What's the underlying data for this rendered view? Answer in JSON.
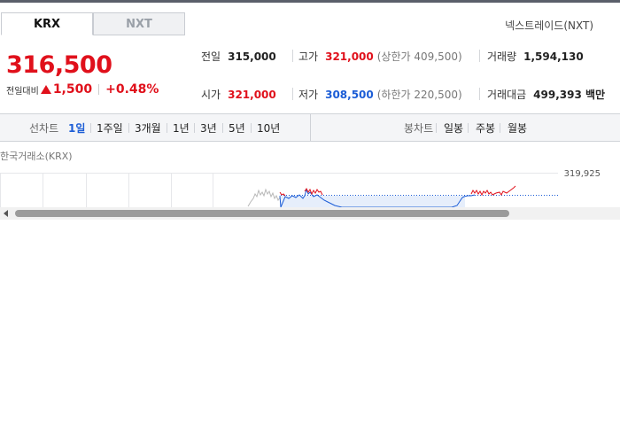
{
  "tabs": {
    "krx": "KRX",
    "nxt": "NXT"
  },
  "nxt_link": "넥스트레이드(NXT)",
  "price": {
    "current": "316,500",
    "change_label": "전일대비",
    "change_amount": "1,500",
    "change_percent": "+0.48%"
  },
  "stats": {
    "prev_close": {
      "label": "전일",
      "value": "315,000"
    },
    "high": {
      "label": "고가",
      "value": "321,000",
      "sub": "(상한가 409,500)"
    },
    "volume": {
      "label": "거래량",
      "value": "1,594,130"
    },
    "open": {
      "label": "시가",
      "value": "321,000"
    },
    "low": {
      "label": "저가",
      "value": "308,500",
      "sub": "(하한가 220,500)"
    },
    "amount": {
      "label": "거래대금",
      "value": "499,393 백만"
    }
  },
  "toolbar": {
    "line_chart_label": "선차트",
    "periods": [
      "1일",
      "1주일",
      "3개월",
      "1년",
      "3년",
      "5년",
      "10년"
    ],
    "candle_label": "봉차트",
    "candle_periods": [
      "일봉",
      "주봉",
      "월봉"
    ]
  },
  "chart_data": {
    "type": "line",
    "caption": "한국거래소(KRX)",
    "y_top_label": "319,925"
  },
  "colors": {
    "up": "#e0101b",
    "down": "#1c5dd6",
    "accent": "#1c5dd6"
  }
}
